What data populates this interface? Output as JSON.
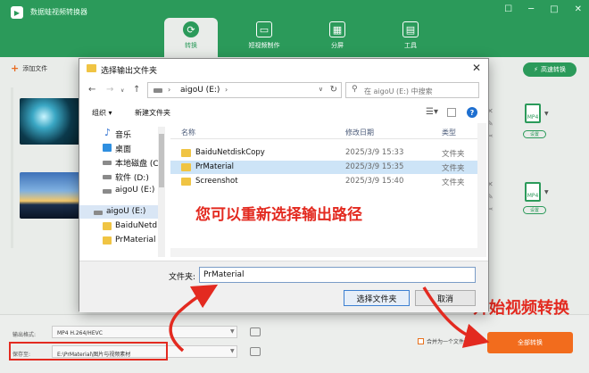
{
  "app": {
    "title": "数据蛙视频转换器",
    "window_controls": [
      "☐",
      "─",
      "□",
      "✕"
    ],
    "tabs": [
      {
        "label": "转换",
        "icon": "convert-icon",
        "glyph": "⟳"
      },
      {
        "label": "短视频制作",
        "icon": "tv-icon",
        "glyph": "▭"
      },
      {
        "label": "分屏",
        "icon": "grid-icon",
        "glyph": "▦"
      },
      {
        "label": "工具",
        "icon": "toolbox-icon",
        "glyph": "▤"
      }
    ],
    "add_file": "添加文件",
    "turbo": "高速转换",
    "format_badge": "MP4",
    "settings": "设置"
  },
  "bottom": {
    "output_format_label": "输出格式:",
    "output_format_value": "MP4 H.264/HEVC",
    "save_to_label": "保存至:",
    "save_to_value": "E:\\PrMaterial\\图片与视频素材",
    "merge_label": "合并为一个文件",
    "convert_all": "全部转换"
  },
  "dialog": {
    "title": "选择输出文件夹",
    "address": {
      "drive": "aigoU (E:)",
      "sep": "›"
    },
    "search_placeholder": "在 aigoU (E:) 中搜索",
    "toolbar": {
      "organize": "组织 ▾",
      "new_folder": "新建文件夹"
    },
    "tree": [
      {
        "label": "音乐",
        "icon": "music-icon",
        "color": "#2c6fd0"
      },
      {
        "label": "桌面",
        "icon": "desktop-icon",
        "color": "#2f8fe0"
      },
      {
        "label": "本地磁盘 (C",
        "icon": "drive-icon",
        "color": "#8a8a8a"
      },
      {
        "label": "软件 (D:)",
        "icon": "drive-icon",
        "color": "#8a8a8a"
      },
      {
        "label": "aigoU (E:)",
        "icon": "drive-icon",
        "color": "#8a8a8a"
      },
      {
        "label": "aigoU (E:)",
        "icon": "drive-icon",
        "color": "#8a8a8a"
      },
      {
        "label": "BaiduNetd",
        "icon": "folder-icon",
        "color": "#f0c443"
      },
      {
        "label": "PrMaterial",
        "icon": "folder-icon",
        "color": "#f0c443"
      }
    ],
    "columns": {
      "name": "名称",
      "date": "修改日期",
      "type": "类型"
    },
    "rows": [
      {
        "name": "BaiduNetdiskCopy",
        "date": "2025/3/9 15:33",
        "type": "文件夹"
      },
      {
        "name": "PrMaterial",
        "date": "2025/3/9 15:35",
        "type": "文件夹"
      },
      {
        "name": "Screenshot",
        "date": "2025/3/9 15:40",
        "type": "文件夹"
      }
    ],
    "folder_label": "文件夹:",
    "folder_value": "PrMaterial",
    "choose_button": "选择文件夹",
    "cancel_button": "取消"
  },
  "annotations": {
    "reselect": "您可以重新选择输出路径",
    "start_convert": "开始视频转换",
    "color": "#e32a20"
  },
  "colors": {
    "brand_green": "#2b9a5a",
    "accent_orange": "#f26c1d"
  }
}
